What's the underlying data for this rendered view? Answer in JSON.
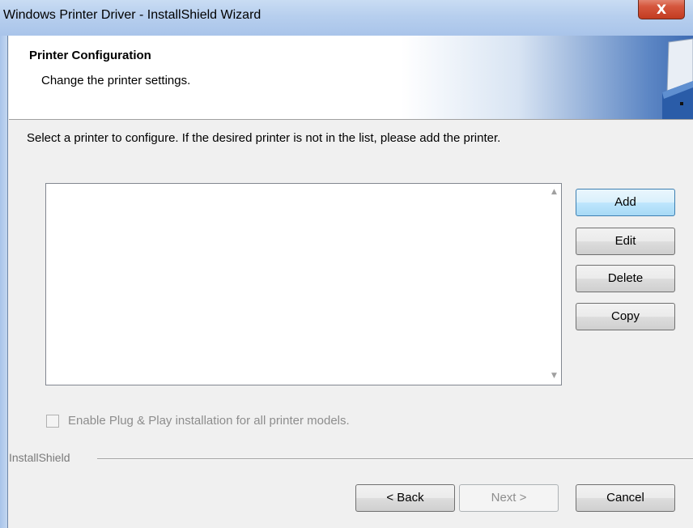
{
  "window": {
    "title": "Windows Printer Driver - InstallShield Wizard",
    "close_glyph": "X"
  },
  "header": {
    "title": "Printer Configuration",
    "subtitle": "Change the printer settings.",
    "icon": "printer-icon"
  },
  "instruction": "Select a printer to configure. If the desired printer is not in the list, please add the printer.",
  "printer_list": {
    "items": [],
    "scroll_up": "▲",
    "scroll_down": "▼"
  },
  "actions": {
    "add": "Add",
    "edit": "Edit",
    "delete": "Delete",
    "copy": "Copy"
  },
  "plug_and_play": {
    "label": "Enable Plug & Play installation for all printer models.",
    "checked": false,
    "enabled": false
  },
  "footer": {
    "brand": "InstallShield",
    "back": "< Back",
    "next": "Next >",
    "cancel": "Cancel"
  },
  "colors": {
    "title_bar": "#b7cfee",
    "close_button": "#d6583f",
    "focus_border": "#3c7fb1",
    "disabled_text": "#8d8d8d"
  }
}
